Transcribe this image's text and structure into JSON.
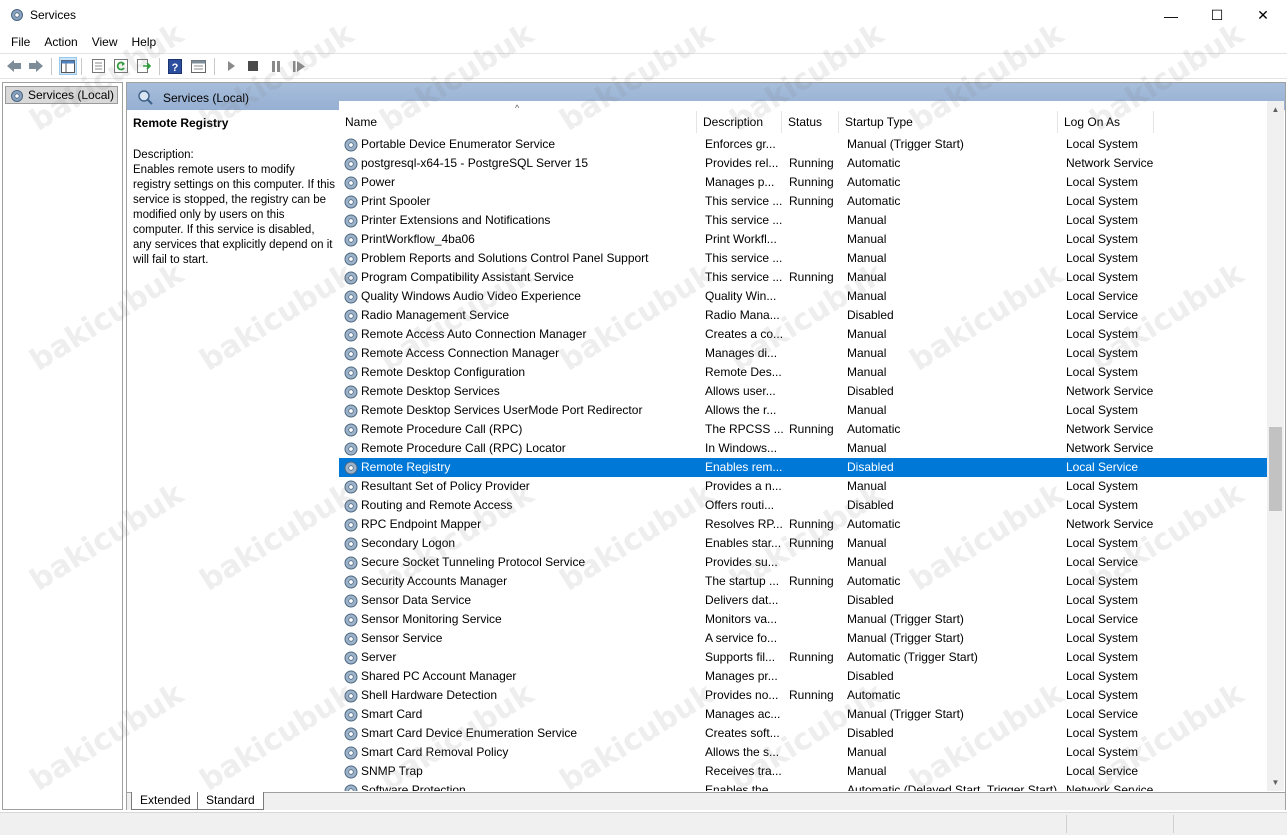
{
  "window": {
    "title": "Services",
    "minimize_glyph": "—",
    "maximize_glyph": "☐",
    "close_glyph": "✕"
  },
  "menu": [
    "File",
    "Action",
    "View",
    "Help"
  ],
  "tree": {
    "root_label": "Services (Local)"
  },
  "panel": {
    "header": "Services (Local)"
  },
  "description": {
    "service_title": "Remote Registry",
    "label": "Description:",
    "text": "Enables remote users to modify registry settings on this computer. If this service is stopped, the registry can be modified only by users on this computer. If this service is disabled, any services that explicitly depend on it will fail to start."
  },
  "columns": {
    "name": "Name",
    "description": "Description",
    "status": "Status",
    "startup": "Startup Type",
    "logon": "Log On As"
  },
  "rows": [
    {
      "name": "Portable Device Enumerator Service",
      "desc": "Enforces gr...",
      "status": "",
      "startup": "Manual (Trigger Start)",
      "logon": "Local System"
    },
    {
      "name": "postgresql-x64-15 - PostgreSQL Server 15",
      "desc": "Provides rel...",
      "status": "Running",
      "startup": "Automatic",
      "logon": "Network Service"
    },
    {
      "name": "Power",
      "desc": "Manages p...",
      "status": "Running",
      "startup": "Automatic",
      "logon": "Local System"
    },
    {
      "name": "Print Spooler",
      "desc": "This service ...",
      "status": "Running",
      "startup": "Automatic",
      "logon": "Local System"
    },
    {
      "name": "Printer Extensions and Notifications",
      "desc": "This service ...",
      "status": "",
      "startup": "Manual",
      "logon": "Local System"
    },
    {
      "name": "PrintWorkflow_4ba06",
      "desc": "Print Workfl...",
      "status": "",
      "startup": "Manual",
      "logon": "Local System"
    },
    {
      "name": "Problem Reports and Solutions Control Panel Support",
      "desc": "This service ...",
      "status": "",
      "startup": "Manual",
      "logon": "Local System"
    },
    {
      "name": "Program Compatibility Assistant Service",
      "desc": "This service ...",
      "status": "Running",
      "startup": "Manual",
      "logon": "Local System"
    },
    {
      "name": "Quality Windows Audio Video Experience",
      "desc": "Quality Win...",
      "status": "",
      "startup": "Manual",
      "logon": "Local Service"
    },
    {
      "name": "Radio Management Service",
      "desc": "Radio Mana...",
      "status": "",
      "startup": "Disabled",
      "logon": "Local Service"
    },
    {
      "name": "Remote Access Auto Connection Manager",
      "desc": "Creates a co...",
      "status": "",
      "startup": "Manual",
      "logon": "Local System"
    },
    {
      "name": "Remote Access Connection Manager",
      "desc": "Manages di...",
      "status": "",
      "startup": "Manual",
      "logon": "Local System"
    },
    {
      "name": "Remote Desktop Configuration",
      "desc": "Remote Des...",
      "status": "",
      "startup": "Manual",
      "logon": "Local System"
    },
    {
      "name": "Remote Desktop Services",
      "desc": "Allows user...",
      "status": "",
      "startup": "Disabled",
      "logon": "Network Service"
    },
    {
      "name": "Remote Desktop Services UserMode Port Redirector",
      "desc": "Allows the r...",
      "status": "",
      "startup": "Manual",
      "logon": "Local System"
    },
    {
      "name": "Remote Procedure Call (RPC)",
      "desc": "The RPCSS ...",
      "status": "Running",
      "startup": "Automatic",
      "logon": "Network Service"
    },
    {
      "name": "Remote Procedure Call (RPC) Locator",
      "desc": "In Windows...",
      "status": "",
      "startup": "Manual",
      "logon": "Network Service"
    },
    {
      "name": "Remote Registry",
      "desc": "Enables rem...",
      "status": "",
      "startup": "Disabled",
      "logon": "Local Service",
      "selected": true
    },
    {
      "name": "Resultant Set of Policy Provider",
      "desc": "Provides a n...",
      "status": "",
      "startup": "Manual",
      "logon": "Local System"
    },
    {
      "name": "Routing and Remote Access",
      "desc": "Offers routi...",
      "status": "",
      "startup": "Disabled",
      "logon": "Local System"
    },
    {
      "name": "RPC Endpoint Mapper",
      "desc": "Resolves RP...",
      "status": "Running",
      "startup": "Automatic",
      "logon": "Network Service"
    },
    {
      "name": "Secondary Logon",
      "desc": "Enables star...",
      "status": "Running",
      "startup": "Manual",
      "logon": "Local System"
    },
    {
      "name": "Secure Socket Tunneling Protocol Service",
      "desc": "Provides su...",
      "status": "",
      "startup": "Manual",
      "logon": "Local Service"
    },
    {
      "name": "Security Accounts Manager",
      "desc": "The startup ...",
      "status": "Running",
      "startup": "Automatic",
      "logon": "Local System"
    },
    {
      "name": "Sensor Data Service",
      "desc": "Delivers dat...",
      "status": "",
      "startup": "Disabled",
      "logon": "Local System"
    },
    {
      "name": "Sensor Monitoring Service",
      "desc": "Monitors va...",
      "status": "",
      "startup": "Manual (Trigger Start)",
      "logon": "Local Service"
    },
    {
      "name": "Sensor Service",
      "desc": "A service fo...",
      "status": "",
      "startup": "Manual (Trigger Start)",
      "logon": "Local System"
    },
    {
      "name": "Server",
      "desc": "Supports fil...",
      "status": "Running",
      "startup": "Automatic (Trigger Start)",
      "logon": "Local System"
    },
    {
      "name": "Shared PC Account Manager",
      "desc": "Manages pr...",
      "status": "",
      "startup": "Disabled",
      "logon": "Local System"
    },
    {
      "name": "Shell Hardware Detection",
      "desc": "Provides no...",
      "status": "Running",
      "startup": "Automatic",
      "logon": "Local System"
    },
    {
      "name": "Smart Card",
      "desc": "Manages ac...",
      "status": "",
      "startup": "Manual (Trigger Start)",
      "logon": "Local Service"
    },
    {
      "name": "Smart Card Device Enumeration Service",
      "desc": "Creates soft...",
      "status": "",
      "startup": "Disabled",
      "logon": "Local System"
    },
    {
      "name": "Smart Card Removal Policy",
      "desc": "Allows the s...",
      "status": "",
      "startup": "Manual",
      "logon": "Local System"
    },
    {
      "name": "SNMP Trap",
      "desc": "Receives tra...",
      "status": "",
      "startup": "Manual",
      "logon": "Local Service"
    },
    {
      "name": "Software Protection",
      "desc": "Enables the ...",
      "status": "",
      "startup": "Automatic (Delayed Start, Trigger Start)",
      "logon": "Network Service"
    }
  ],
  "tabs": [
    "Extended",
    "Standard"
  ],
  "watermark_text": "bakicubuk",
  "icons": {
    "app": "gear-icon",
    "back": "back-arrow-icon",
    "forward": "forward-arrow-icon",
    "console-tree": "console-tree-icon",
    "properties": "properties-icon",
    "refresh": "refresh-icon",
    "export": "export-list-icon",
    "help": "help-icon",
    "view": "view-icon",
    "start": "play-icon",
    "stop": "stop-icon",
    "pause": "pause-icon",
    "restart": "restart-icon"
  },
  "colors": {
    "selection": "#0078d7",
    "header_band": "#a7bedb"
  }
}
